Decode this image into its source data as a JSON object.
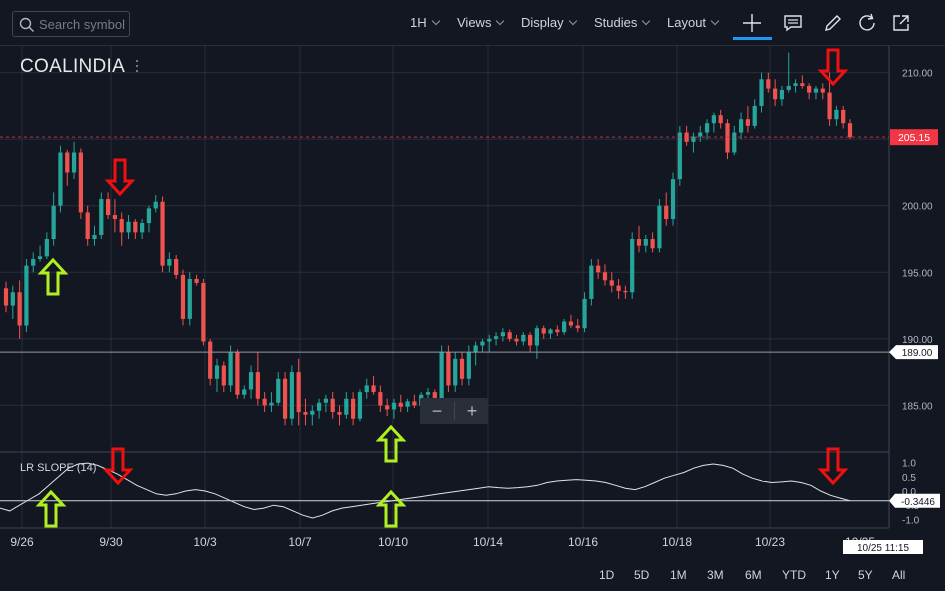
{
  "toolbar": {
    "search_placeholder": "Search symbol",
    "interval": "1H",
    "views": "Views",
    "display": "Display",
    "studies": "Studies",
    "layout": "Layout"
  },
  "symbol": "COALINDIA",
  "indicator_label": "LR SLOPE (14)",
  "zoom": {
    "minus": "−",
    "plus": "+"
  },
  "ranges": [
    "1D",
    "5D",
    "1M",
    "3M",
    "6M",
    "YTD",
    "1Y",
    "5Y",
    "All"
  ],
  "colors": {
    "background": "#131722",
    "up": "#26a69a",
    "down": "#ef5350",
    "grid": "#2a2e39",
    "arrow_up": "#b0f020",
    "arrow_down": "#f01010",
    "price_marker": "#f23645"
  },
  "chart_data": [
    {
      "type": "candlestick",
      "x_ticks": [
        "9/26",
        "9/30",
        "10/3",
        "10/7",
        "10/10",
        "10/14",
        "10/16",
        "10/18",
        "10/23",
        "10/25"
      ],
      "y_ticks": [
        "185.00",
        "190.00",
        "195.00",
        "200.00",
        "205.00",
        "210.00"
      ],
      "ylim": [
        181.5,
        212
      ],
      "last_price": "205.15",
      "cursor_price": "189.00",
      "cursor_time": "10/25 11:15",
      "candles": [
        [
          193.8,
          194.3,
          192.0,
          192.5
        ],
        [
          192.5,
          194.0,
          191.5,
          193.5
        ],
        [
          193.5,
          194.4,
          190.0,
          191.0
        ],
        [
          191.0,
          196.0,
          190.5,
          195.5
        ],
        [
          195.5,
          196.5,
          195.0,
          196.0
        ],
        [
          196.0,
          197.0,
          195.8,
          196.2
        ],
        [
          196.2,
          198.0,
          196.0,
          197.5
        ],
        [
          197.5,
          201.0,
          197.0,
          200.0
        ],
        [
          200.0,
          204.5,
          199.5,
          204.0
        ],
        [
          204.0,
          204.2,
          201.5,
          202.5
        ],
        [
          202.5,
          204.8,
          202.0,
          204.0
        ],
        [
          204.0,
          204.3,
          199.0,
          199.5
        ],
        [
          199.5,
          200.0,
          197.0,
          197.5
        ],
        [
          197.5,
          198.5,
          197.0,
          197.8
        ],
        [
          197.8,
          201.0,
          197.5,
          200.5
        ],
        [
          200.5,
          201.0,
          199.0,
          199.3
        ],
        [
          199.3,
          200.5,
          198.0,
          199.0
        ],
        [
          199.0,
          199.5,
          197.0,
          198.0
        ],
        [
          198.0,
          199.3,
          197.5,
          198.8
        ],
        [
          198.8,
          199.0,
          197.5,
          198.0
        ],
        [
          198.0,
          199.0,
          197.5,
          198.7
        ],
        [
          198.7,
          200.0,
          198.0,
          199.8
        ],
        [
          199.8,
          200.8,
          199.5,
          200.3
        ],
        [
          200.3,
          200.7,
          195.0,
          195.5
        ],
        [
          195.5,
          196.5,
          195.0,
          196.0
        ],
        [
          196.0,
          196.3,
          194.5,
          194.8
        ],
        [
          194.8,
          195.2,
          191.0,
          191.5
        ],
        [
          191.5,
          195.0,
          191.0,
          194.5
        ],
        [
          194.5,
          194.8,
          194.0,
          194.2
        ],
        [
          194.2,
          194.5,
          189.5,
          189.8
        ],
        [
          189.8,
          190.0,
          186.5,
          187.0
        ],
        [
          187.0,
          188.5,
          186.0,
          188.0
        ],
        [
          188.0,
          188.3,
          186.0,
          186.5
        ],
        [
          186.5,
          189.5,
          186.0,
          189.0
        ],
        [
          189.0,
          189.2,
          185.5,
          185.8
        ],
        [
          185.8,
          186.5,
          185.5,
          186.2
        ],
        [
          186.2,
          188.0,
          185.5,
          187.5
        ],
        [
          187.5,
          189.0,
          185.0,
          185.5
        ],
        [
          185.5,
          186.0,
          184.5,
          185.0
        ],
        [
          185.0,
          186.0,
          184.5,
          185.2
        ],
        [
          185.2,
          187.5,
          185.0,
          187.0
        ],
        [
          187.0,
          187.5,
          183.5,
          184.0
        ],
        [
          184.0,
          188.0,
          183.5,
          187.5
        ],
        [
          187.5,
          188.5,
          183.5,
          184.5
        ],
        [
          184.5,
          185.5,
          183.5,
          184.3
        ],
        [
          184.3,
          185.0,
          183.5,
          184.6
        ],
        [
          184.6,
          185.5,
          184.0,
          185.2
        ],
        [
          185.2,
          185.8,
          184.5,
          185.5
        ],
        [
          185.5,
          186.0,
          184.0,
          184.5
        ],
        [
          184.5,
          185.0,
          183.5,
          184.3
        ],
        [
          184.3,
          186.0,
          184.0,
          185.5
        ],
        [
          185.5,
          186.0,
          183.5,
          184.0
        ],
        [
          184.0,
          186.2,
          183.8,
          186.0
        ],
        [
          186.0,
          187.0,
          185.5,
          186.5
        ],
        [
          186.5,
          187.2,
          185.8,
          186.0
        ],
        [
          186.0,
          186.5,
          184.5,
          185.0
        ],
        [
          185.0,
          185.5,
          184.2,
          184.7
        ],
        [
          184.7,
          185.5,
          184.0,
          185.2
        ],
        [
          185.2,
          185.8,
          184.5,
          184.9
        ],
        [
          184.9,
          185.5,
          184.5,
          185.3
        ],
        [
          185.3,
          185.8,
          184.8,
          185.0
        ],
        [
          185.0,
          186.0,
          184.8,
          185.8
        ],
        [
          185.8,
          186.3,
          185.5,
          186.0
        ],
        [
          186.0,
          186.2,
          185.0,
          185.5
        ],
        [
          185.5,
          189.5,
          185.0,
          189.0
        ],
        [
          189.0,
          189.5,
          186.0,
          186.5
        ],
        [
          186.5,
          189.0,
          186.0,
          188.5
        ],
        [
          188.5,
          189.0,
          186.5,
          187.0
        ],
        [
          187.0,
          189.5,
          186.5,
          189.0
        ],
        [
          189.0,
          189.8,
          188.0,
          189.5
        ],
        [
          189.5,
          190.0,
          189.0,
          189.8
        ],
        [
          189.8,
          190.3,
          189.0,
          190.0
        ],
        [
          190.0,
          190.5,
          189.5,
          190.2
        ],
        [
          190.2,
          190.8,
          189.8,
          190.5
        ],
        [
          190.5,
          190.7,
          189.8,
          190.0
        ],
        [
          190.0,
          190.3,
          189.5,
          189.8
        ],
        [
          189.8,
          190.5,
          189.5,
          190.3
        ],
        [
          190.3,
          190.5,
          189.0,
          189.5
        ],
        [
          189.5,
          191.0,
          188.5,
          190.8
        ],
        [
          190.8,
          191.0,
          190.0,
          190.4
        ],
        [
          190.4,
          190.8,
          190.0,
          190.7
        ],
        [
          190.7,
          191.0,
          190.2,
          190.5
        ],
        [
          190.5,
          191.5,
          190.3,
          191.3
        ],
        [
          191.3,
          191.8,
          190.8,
          191.0
        ],
        [
          191.0,
          191.5,
          190.5,
          190.8
        ],
        [
          190.8,
          193.5,
          190.5,
          193.0
        ],
        [
          193.0,
          196.0,
          192.5,
          195.5
        ],
        [
          195.5,
          196.0,
          194.5,
          195.0
        ],
        [
          195.0,
          195.6,
          194.0,
          194.4
        ],
        [
          194.4,
          195.0,
          193.5,
          194.0
        ],
        [
          194.0,
          194.5,
          193.0,
          193.6
        ],
        [
          193.6,
          194.0,
          193.0,
          193.5
        ],
        [
          193.5,
          198.0,
          193.0,
          197.5
        ],
        [
          197.5,
          198.5,
          196.5,
          197.0
        ],
        [
          197.0,
          197.8,
          196.5,
          197.5
        ],
        [
          197.5,
          198.0,
          196.5,
          196.8
        ],
        [
          196.8,
          200.5,
          196.5,
          200.0
        ],
        [
          200.0,
          201.0,
          198.5,
          199.0
        ],
        [
          199.0,
          202.5,
          198.5,
          202.0
        ],
        [
          202.0,
          206.0,
          201.5,
          205.5
        ],
        [
          205.5,
          206.0,
          204.5,
          204.8
        ],
        [
          204.8,
          205.5,
          204.0,
          205.2
        ],
        [
          205.2,
          206.0,
          204.8,
          205.5
        ],
        [
          205.5,
          206.5,
          205.0,
          206.2
        ],
        [
          206.2,
          207.0,
          205.5,
          206.8
        ],
        [
          206.8,
          207.2,
          205.8,
          206.2
        ],
        [
          206.2,
          206.5,
          203.5,
          204.0
        ],
        [
          204.0,
          206.0,
          203.8,
          205.5
        ],
        [
          205.5,
          207.0,
          205.0,
          206.5
        ],
        [
          206.5,
          207.5,
          205.5,
          206.0
        ],
        [
          206.0,
          208.0,
          205.8,
          207.5
        ],
        [
          207.5,
          210.0,
          207.0,
          209.5
        ],
        [
          209.5,
          210.0,
          208.5,
          208.8
        ],
        [
          208.8,
          209.5,
          207.5,
          208.0
        ],
        [
          208.0,
          209.0,
          207.5,
          208.7
        ],
        [
          208.7,
          211.5,
          208.5,
          209.0
        ],
        [
          209.0,
          209.5,
          208.5,
          209.2
        ],
        [
          209.2,
          209.8,
          208.8,
          209.0
        ],
        [
          209.0,
          209.2,
          208.0,
          208.5
        ],
        [
          208.5,
          209.0,
          208.0,
          208.8
        ],
        [
          208.8,
          209.2,
          208.0,
          208.5
        ],
        [
          208.5,
          210.0,
          206.0,
          206.5
        ],
        [
          206.5,
          207.5,
          206.0,
          207.2
        ],
        [
          207.2,
          207.5,
          205.8,
          206.2
        ],
        [
          206.2,
          206.5,
          205.0,
          205.15
        ]
      ]
    },
    {
      "type": "line",
      "name": "LR SLOPE (14)",
      "y_ticks": [
        "1.0",
        "0.5",
        "0.0",
        "-0.5",
        "-1.0"
      ],
      "ylim": [
        -1.3,
        1.3
      ],
      "last_value": "-0.3446",
      "values": [
        -0.6,
        -0.7,
        -0.5,
        -0.3,
        -0.1,
        0.2,
        0.5,
        0.8,
        0.95,
        0.98,
        0.9,
        0.75,
        0.6,
        0.4,
        0.2,
        0.05,
        -0.1,
        -0.15,
        -0.1,
        0.0,
        0.05,
        0.0,
        -0.1,
        -0.25,
        -0.4,
        -0.55,
        -0.65,
        -0.6,
        -0.5,
        -0.55,
        -0.7,
        -0.85,
        -0.95,
        -0.85,
        -0.7,
        -0.6,
        -0.55,
        -0.5,
        -0.45,
        -0.4,
        -0.35,
        -0.3,
        -0.25,
        -0.2,
        -0.15,
        -0.1,
        -0.05,
        0.0,
        0.05,
        0.1,
        0.15,
        0.12,
        0.1,
        0.12,
        0.15,
        0.2,
        0.3,
        0.35,
        0.38,
        0.4,
        0.38,
        0.35,
        0.3,
        0.2,
        0.1,
        0.05,
        0.15,
        0.3,
        0.45,
        0.55,
        0.65,
        0.8,
        0.9,
        0.95,
        0.9,
        0.8,
        0.6,
        0.45,
        0.35,
        0.3,
        0.32,
        0.35,
        0.3,
        0.2,
        0.0,
        -0.15,
        -0.25,
        -0.34
      ]
    }
  ]
}
